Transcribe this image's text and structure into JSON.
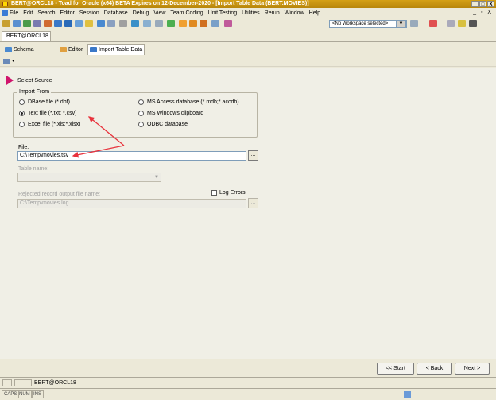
{
  "app": {
    "title": "BERT@ORCL18 - Toad for Oracle (x64) BETA Expires on 12-December-2020 - [Import Table Data (BERT.MOVIES)]"
  },
  "menu": [
    "File",
    "Edit",
    "Search",
    "Editor",
    "Session",
    "Database",
    "Debug",
    "View",
    "Team Coding",
    "Unit Testing",
    "Utilities",
    "Rerun",
    "Window",
    "Help"
  ],
  "window_buttons": {
    "min": "_",
    "max": "□",
    "close": "X"
  },
  "mdi_buttons": "_ ▫ X",
  "toolbar": {
    "workspace": "<No Workspace selected>"
  },
  "connection_tab": "BERT@ORCL18",
  "tabs": [
    {
      "label": "Schema Browser"
    },
    {
      "label": "Editor"
    },
    {
      "label": "Import Table Data"
    }
  ],
  "wizard": {
    "step_title": "Select Source",
    "group_title": "Import From",
    "options": [
      {
        "label": "DBase file (*.dbf)",
        "checked": false
      },
      {
        "label": "MS Access database (*.mdb;*.accdb)",
        "checked": false
      },
      {
        "label": "Text file (*.txt; *.csv)",
        "checked": true
      },
      {
        "label": "MS Windows clipboard",
        "checked": false
      },
      {
        "label": "Excel file (*.xls;*.xlsx)",
        "checked": false
      },
      {
        "label": "ODBC database",
        "checked": false
      }
    ],
    "file_label": "File:",
    "file_value": "C:\\Temp\\movies.tsv",
    "browse_label": "...",
    "table_label": "Table name:",
    "table_value": "",
    "log_errors_label": "Log Errors",
    "rejected_label": "Rejected record output file name:",
    "rejected_value": "C:\\Temp\\movies.log"
  },
  "nav": {
    "start": "<< Start",
    "back": "< Back",
    "next": "Next >"
  },
  "taskbar": {
    "conn": "BERT@ORCL18"
  },
  "status": {
    "caps": "CAPS",
    "num": "NUM",
    "ins": "INS"
  },
  "colors": {
    "annotation_arrow": "#e8323c",
    "step_marker": "#d0146c",
    "title_bar": "#d4a017"
  }
}
